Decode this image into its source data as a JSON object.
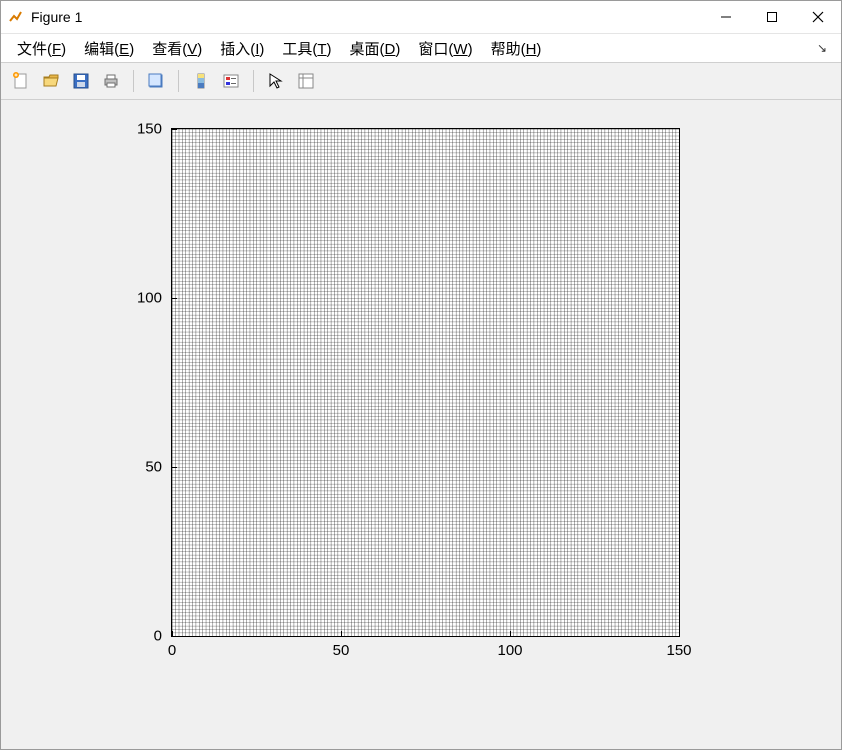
{
  "window": {
    "title": "Figure 1"
  },
  "menu": {
    "file": "文件(F)",
    "edit": "编辑(E)",
    "view": "查看(V)",
    "insert": "插入(I)",
    "tools": "工具(T)",
    "desktop": "桌面(D)",
    "window": "窗口(W)",
    "help": "帮助(H)"
  },
  "chart_data": {
    "type": "other",
    "description": "mesh grid plot (dense black rectangular grid over [0,150]×[0,150])",
    "x_range": [
      0,
      150
    ],
    "y_range": [
      0,
      150
    ],
    "grid_count_x": 150,
    "grid_count_y": 150,
    "x_ticks": [
      0,
      50,
      100,
      150
    ],
    "y_ticks": [
      0,
      50,
      100,
      150
    ],
    "title": "",
    "xlabel": "",
    "ylabel": ""
  },
  "ticks": {
    "x0": "0",
    "x1": "50",
    "x2": "100",
    "x3": "150",
    "y0": "0",
    "y1": "50",
    "y2": "100",
    "y3": "150"
  }
}
